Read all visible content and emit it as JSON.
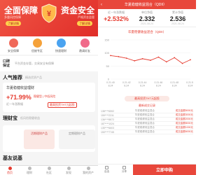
{
  "left": {
    "banner": {
      "title_left": "全面保障",
      "title_right": "资金安全",
      "sub_left": "多重风控保障",
      "sub_right": "严格资金监管",
      "btn_left": "了解详情",
      "btn_right": "了解详情"
    },
    "icons": [
      {
        "label": "安全保障",
        "color": "#f0695a"
      },
      {
        "label": "信披专区",
        "color": "#f5a23a"
      },
      {
        "label": "快速理财",
        "color": "#4aa3f0"
      },
      {
        "label": "邀请好友",
        "color": "#f06a8a"
      }
    ],
    "notice": {
      "tag": "口碑\n保证",
      "text": "平台资金存管，交易安全有保障"
    },
    "hot": {
      "title": "人气推荐",
      "subtitle": "精选优质产品",
      "name": "华夏稳健收益理财",
      "rate": "+71.99%",
      "rate_label": "近一年涨跌幅",
      "tag1": "稳健型 | 中低风险",
      "tag2": "最高投资THT元起投"
    },
    "wealth": {
      "title": "理财宝",
      "subtitle": "低风险稳健收益",
      "box1": "活期理财产品",
      "box2": "定期理财产品"
    },
    "friends": {
      "title": "基友说基"
    },
    "tabs": [
      {
        "label": "首页",
        "active": true
      },
      {
        "label": "理财",
        "active": false
      },
      {
        "label": "社区",
        "active": false
      },
      {
        "label": "发现",
        "active": false
      },
      {
        "label": "我的资产",
        "active": false
      }
    ]
  },
  "right": {
    "header_title": "华夏稳健收益混合（QDII）",
    "stats": [
      {
        "label": "近一年涨跌幅",
        "value": "+2.532%",
        "highlight": true,
        "date": ""
      },
      {
        "label": "单位净值",
        "value": "2.332",
        "highlight": false,
        "date": "2021-08-24"
      },
      {
        "label": "累计净值",
        "value": "2.536",
        "highlight": false,
        "date": "2021-08-24"
      }
    ],
    "chart_title": "华夏稳健收益混合（QDII）",
    "recommend_btn": "最高投资THT元起投",
    "records_title": "最新成交记录",
    "records": [
      {
        "user": "138****6592",
        "fund": "华夏稳健收益混合",
        "amount": "成交金额5000元"
      },
      {
        "user": "159****2311",
        "fund": "华夏稳健收益混合",
        "amount": "成交金额3000元"
      },
      {
        "user": "136****8872",
        "fund": "华夏稳健收益混合",
        "amount": "成交金额2000元"
      },
      {
        "user": "187****1024",
        "fund": "华夏稳健收益混合",
        "amount": "成交金额8000元"
      },
      {
        "user": "135****6603",
        "fund": "华夏稳健收益混合",
        "amount": "成交金额1000元"
      },
      {
        "user": "150****7745",
        "fund": "华夏稳健收益混合",
        "amount": "成交金额6000元"
      }
    ],
    "bottom": {
      "fav": "自选",
      "share": "分享",
      "buy": "立即申购"
    }
  },
  "chart_data": {
    "type": "line",
    "x": [
      "0.21.40\n8.24",
      "0.21.41\n8.24",
      "0.21.42\n8.24",
      "0.21.43\n8.24",
      "0.21.44\n8.24",
      "0.21.45\n8.24",
      "0.21.46\n8.24",
      "0.21.47\n8.24",
      "0.21.48\n8.24",
      "0.21.49\n8.24",
      "0.21.50\n8.24"
    ],
    "tick_labels": [
      "0.21.40\n8.24",
      "0.21.42\n8.24",
      "0.21.44\n8.24",
      "0.21.46\n8.24",
      "0.21.48\n8.24",
      "0.21.50\n8.24"
    ],
    "values": [
      90,
      86,
      80,
      70,
      78,
      72,
      84,
      66,
      82,
      60,
      74
    ],
    "ylim": [
      0,
      150
    ],
    "yticks": [
      0,
      50,
      100,
      150
    ],
    "color": "#e63b2f",
    "grid": true
  }
}
